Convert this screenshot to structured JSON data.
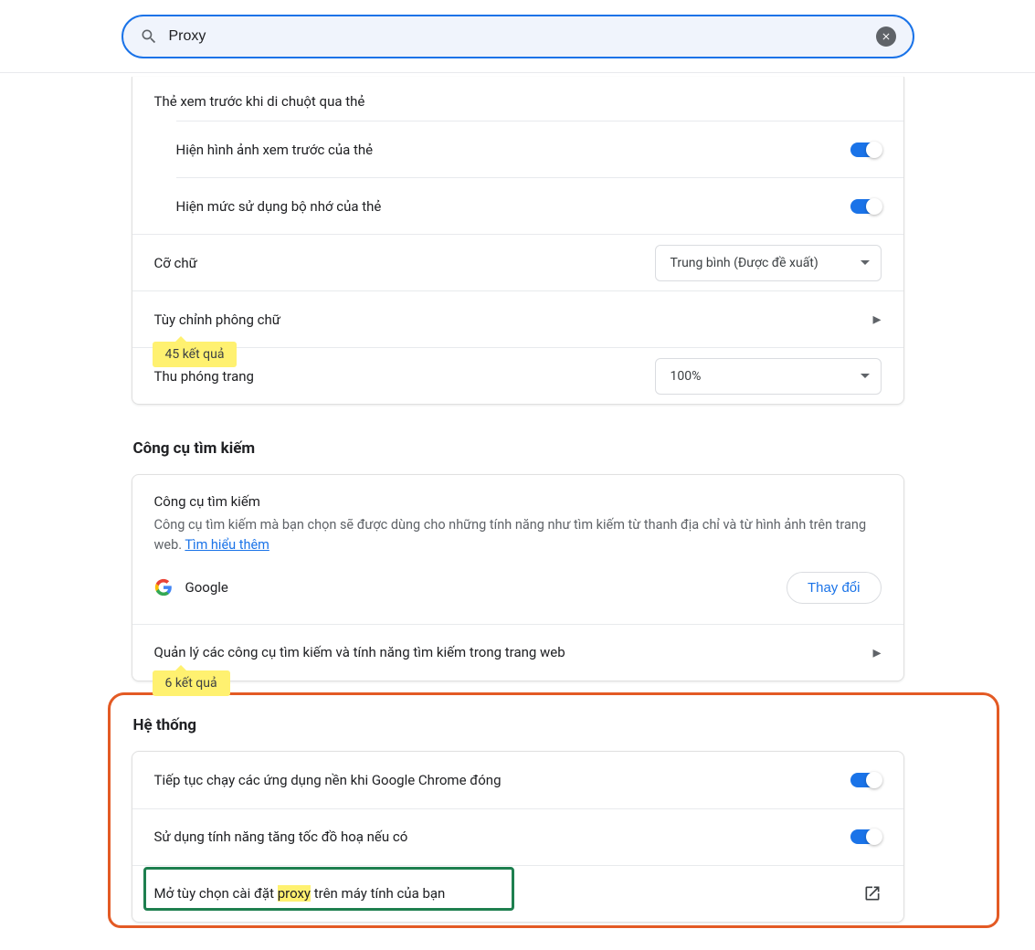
{
  "search": {
    "value": "Proxy"
  },
  "card1": {
    "heading": "Thẻ xem trước khi di chuột qua thẻ",
    "sub1": "Hiện hình ảnh xem trước của thẻ",
    "sub2": "Hiện mức sử dụng bộ nhớ của thẻ",
    "font_size_label": "Cỡ chữ",
    "font_size_value": "Trung bình (Được đề xuất)",
    "customize_fonts": "Tùy chỉnh phông chữ",
    "page_zoom_label": "Thu phóng trang",
    "page_zoom_value": "100%",
    "results_badge": "45 kết quả"
  },
  "search_engine_section": {
    "title": "Công cụ tìm kiếm",
    "sub_title": "Công cụ tìm kiếm",
    "sub_text_1": "Công cụ tìm kiếm mà bạn chọn sẽ được dùng cho những tính năng như tìm kiếm từ thanh địa chỉ và từ hình ảnh trên trang web. ",
    "learn_more": "Tìm hiểu thêm",
    "engine_name": "Google",
    "change_btn": "Thay đổi",
    "manage_row": "Quản lý các công cụ tìm kiếm và tính năng tìm kiếm trong trang web",
    "results_badge": "6 kết quả"
  },
  "system_section": {
    "title": "Hệ thống",
    "row1": "Tiếp tục chạy các ứng dụng nền khi Google Chrome đóng",
    "row2": "Sử dụng tính năng tăng tốc đồ hoạ nếu có",
    "row3_pre": "Mở tùy chọn cài đặt ",
    "row3_hl": "proxy",
    "row3_post": " trên máy tính của bạn"
  }
}
